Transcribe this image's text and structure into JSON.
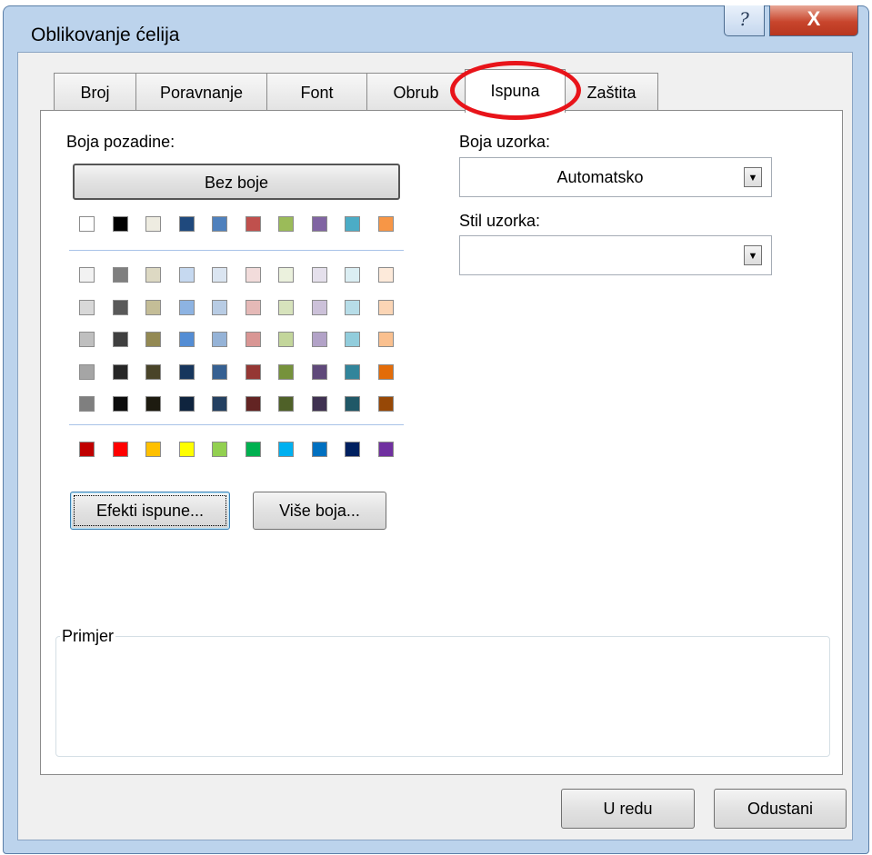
{
  "window": {
    "title": "Oblikovanje ćelija",
    "help_label": "?",
    "close_label": "X"
  },
  "tabs": [
    {
      "label": "Broj",
      "active": false
    },
    {
      "label": "Poravnanje",
      "active": false
    },
    {
      "label": "Font",
      "active": false
    },
    {
      "label": "Obrub",
      "active": false
    },
    {
      "label": "Ispuna",
      "active": true
    },
    {
      "label": "Zaštita",
      "active": false
    }
  ],
  "background": {
    "label": "Boja pozadine:",
    "no_color_label": "Bez boje",
    "theme_base_colors": [
      "#ffffff",
      "#000000",
      "#eeece1",
      "#1f497d",
      "#4f81bd",
      "#c0504d",
      "#9bbb59",
      "#8064a2",
      "#4bacc6",
      "#f79646"
    ],
    "theme_shades": [
      [
        "#f2f2f2",
        "#7f7f7f",
        "#ddd9c3",
        "#c6d9f0",
        "#dbe5f1",
        "#f2dcdb",
        "#ebf1dd",
        "#e5e0ec",
        "#dbeef3",
        "#fdeada"
      ],
      [
        "#d8d8d8",
        "#595959",
        "#c4bd97",
        "#8db3e2",
        "#b8cce4",
        "#e5b9b7",
        "#d7e3bc",
        "#ccc1d9",
        "#b7dde8",
        "#fbd5b5"
      ],
      [
        "#bfbfbf",
        "#3f3f3f",
        "#938953",
        "#548dd4",
        "#95b3d7",
        "#d99694",
        "#c3d69b",
        "#b2a2c7",
        "#92cddc",
        "#fac08f"
      ],
      [
        "#a5a5a5",
        "#262626",
        "#494429",
        "#17365d",
        "#366092",
        "#953734",
        "#76923c",
        "#5f497a",
        "#31859b",
        "#e36c09"
      ],
      [
        "#7f7f7f",
        "#0c0c0c",
        "#1d1b10",
        "#0f243e",
        "#244061",
        "#632423",
        "#4f6128",
        "#3f3151",
        "#205867",
        "#974806"
      ]
    ],
    "standard_colors": [
      "#c00000",
      "#ff0000",
      "#ffc000",
      "#ffff00",
      "#92d050",
      "#00b050",
      "#00b0f0",
      "#0070c0",
      "#002060",
      "#7030a0"
    ],
    "fill_effects_label": "Efekti ispune...",
    "more_colors_label": "Više boja..."
  },
  "pattern": {
    "color_label": "Boja uzorka:",
    "color_value": "Automatsko",
    "style_label": "Stil uzorka:",
    "style_value": ""
  },
  "sample": {
    "label": "Primjer"
  },
  "footer": {
    "ok_label": "U redu",
    "cancel_label": "Odustani"
  }
}
